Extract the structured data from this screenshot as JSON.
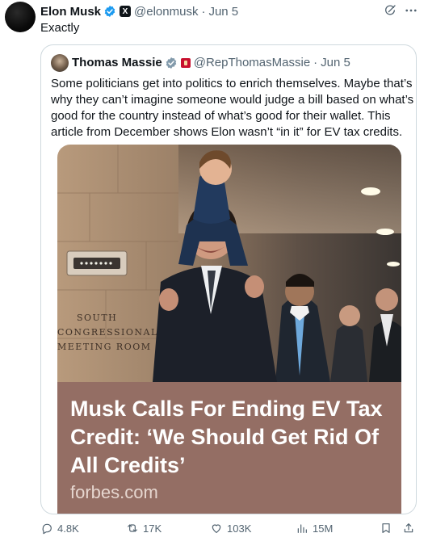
{
  "post": {
    "author_name": "Elon Musk",
    "author_handle": "@elonmusk",
    "separator": "·",
    "date": "Jun 5",
    "text": "Exactly"
  },
  "quoted": {
    "author_name": "Thomas Massie",
    "author_handle": "@RepThomasMassie",
    "separator": "·",
    "date": "Jun 5",
    "text": "Some politicians get into politics to enrich themselves. Maybe that’s why they can’t imagine someone would judge a bill based on what’s good for the country instead of what’s good for their wallet. This article from December shows Elon wasn’t “in it” for EV tax credits.",
    "card": {
      "title": "Musk Calls For Ending EV Tax Credit: ‘We Should Get Rid Of All Credits’",
      "domain": "forbes.com",
      "sign_text": [
        "SOUTH",
        "CONGRESSIONAL",
        "MEETING ROOM"
      ]
    }
  },
  "actions": {
    "replies": "4.8K",
    "reposts": "17K",
    "likes": "103K",
    "views": "15M"
  },
  "icons": {
    "verified": "verified-badge-icon",
    "affiliate": "x-affiliate-icon",
    "grok": "grok-icon",
    "more": "more-icon",
    "reply": "reply-icon",
    "repost": "repost-icon",
    "like": "like-icon",
    "views": "views-icon",
    "bookmark": "bookmark-icon",
    "share": "share-icon"
  },
  "colors": {
    "verified": "#1d9bf0",
    "card_caption_bg": "#946e64",
    "muted": "#536471"
  }
}
